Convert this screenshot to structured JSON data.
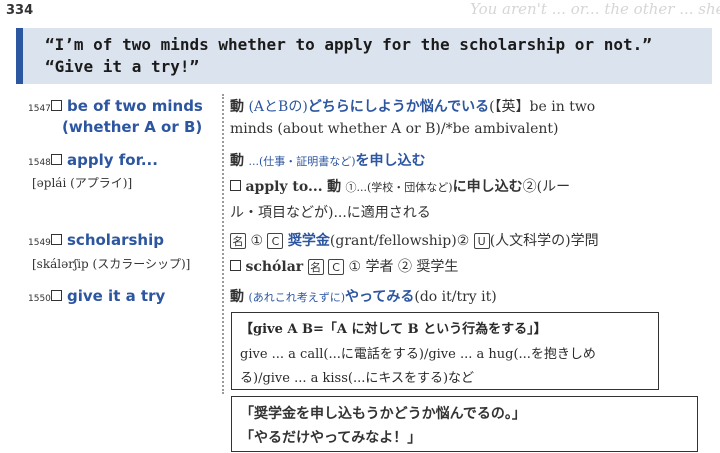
{
  "page_number": "334",
  "faded_bleed_text": "You aren't ... or... the other ... she also",
  "dialogue": {
    "line1": "“I’m of two minds whether to apply for the scholarship or not.”",
    "line2": "“Give it a try!”"
  },
  "entries": [
    {
      "num": "1547",
      "headword": "be of two minds",
      "headword2": "(whether A or B)",
      "pos": "動",
      "def_line1_prefix": "(AとBの)",
      "def_line1_main": "どちらにしようか悩んでいる",
      "def_line1_rest": "(【英】be in two",
      "def_line2": "minds (about whether A or B)/*be ambivalent)"
    },
    {
      "num": "1548",
      "headword": "apply for...",
      "pron": "[əplái (アプライ)]",
      "pos": "動",
      "def_line1_prefix": "...(仕事・証明書など)",
      "def_line1_main": "を申し込む",
      "sub_line1_head": "apply to...",
      "sub_line1_pos": "動",
      "sub_line1_text": "①...(学校・団体など)",
      "sub_line1_main": "に申し込む",
      "sub_line1_tail": "②(ルー",
      "sub_line2": "ル・項目などが)...に適用される"
    },
    {
      "num": "1549",
      "headword": "scholarship",
      "pron": "[skálərʃip (スカラーシップ)]",
      "pos": "名",
      "def_line1_c": "C",
      "def_line1_main": "奨学金",
      "def_line1_rest": "(grant/fellowship)",
      "def_line1_u": "U",
      "def_line1_tail": "(人文科学の)学問",
      "sub_line1_head": "schólar",
      "sub_line1_pos": "名",
      "sub_line1_c": "C",
      "sub_line1_rest": "① 学者 ② 奨学生"
    },
    {
      "num": "1550",
      "headword": "give it a try",
      "pos": "動",
      "def_line1_prefix": "(あれこれ考えずに)",
      "def_line1_main": "やってみる",
      "def_line1_rest": "(do it/try it)"
    }
  ],
  "info_box": {
    "title": "【give A B=「A に対して B という行為をする」】",
    "line1": "give ... a call(...に電話をする)/give ... a hug(...を抱きしめ",
    "line2": "る)/give ... a kiss(...にキスをする)など"
  },
  "translation_box": {
    "line1": "「奨学金を申し込もうかどうか悩んでるの。」",
    "line2": "「やるだけやってみなよ！」"
  },
  "markers": {
    "circle1": "①",
    "circle2": "②"
  }
}
